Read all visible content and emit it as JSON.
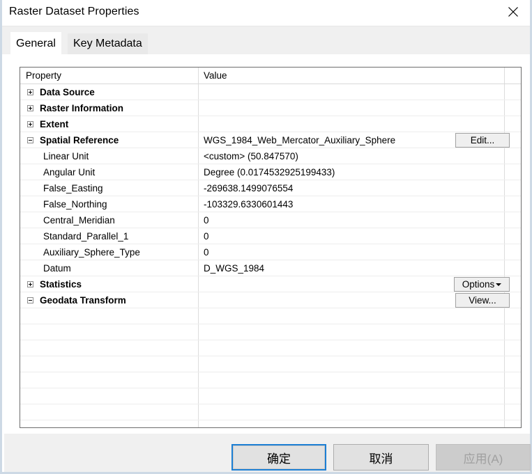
{
  "window": {
    "title": "Raster Dataset Properties",
    "close_icon": "close-icon"
  },
  "tabs": [
    {
      "label": "General",
      "selected": true
    },
    {
      "label": "Key Metadata",
      "selected": false
    }
  ],
  "grid": {
    "columns": [
      "Property",
      "Value"
    ],
    "rows": [
      {
        "property": "Data Source",
        "value": "",
        "style": "group",
        "expander": "plus"
      },
      {
        "property": "Raster Information",
        "value": "",
        "style": "group",
        "expander": "plus"
      },
      {
        "property": "Extent",
        "value": "",
        "style": "group",
        "expander": "plus"
      },
      {
        "property": "Spatial Reference",
        "value": "WGS_1984_Web_Mercator_Auxiliary_Sphere",
        "style": "group",
        "expander": "minus",
        "button": "edit"
      },
      {
        "property": "Linear Unit",
        "value": "<custom> (50.847570)",
        "style": "child"
      },
      {
        "property": "Angular Unit",
        "value": "Degree (0.0174532925199433)",
        "style": "child"
      },
      {
        "property": "False_Easting",
        "value": "-269638.1499076554",
        "style": "child"
      },
      {
        "property": "False_Northing",
        "value": "-103329.6330601443",
        "style": "child"
      },
      {
        "property": "Central_Meridian",
        "value": "0",
        "style": "child"
      },
      {
        "property": "Standard_Parallel_1",
        "value": "0",
        "style": "child"
      },
      {
        "property": "Auxiliary_Sphere_Type",
        "value": "0",
        "style": "child"
      },
      {
        "property": "Datum",
        "value": "D_WGS_1984",
        "style": "child"
      },
      {
        "property": "Statistics",
        "value": "",
        "style": "group",
        "expander": "plus",
        "button": "options"
      },
      {
        "property": "Geodata Transform",
        "value": "",
        "style": "group",
        "expander": "minus",
        "button": "view"
      }
    ],
    "empty_row_count": 8,
    "buttons": {
      "edit": "Edit...",
      "options": "Options",
      "view": "View..."
    }
  },
  "footer": {
    "ok": "确定",
    "cancel": "取消",
    "apply": "应用(A)",
    "apply_disabled": true
  },
  "colors": {
    "window_border": "#cdd9e5",
    "tab_strip_bg": "#f0f0f0",
    "grid_border": "#6d6d6d",
    "focus_blue": "#1c7fd4",
    "disabled_text": "#a0a0a0"
  }
}
